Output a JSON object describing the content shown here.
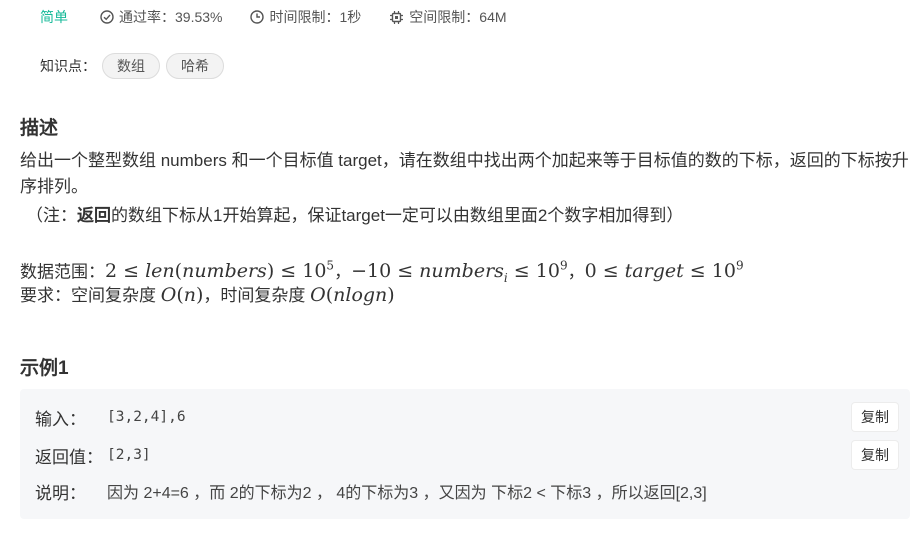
{
  "meta": {
    "difficulty": "简单",
    "pass_rate": "通过率：39.53%",
    "time_limit": "时间限制：1秒",
    "space_limit": "空间限制：64M",
    "difficulty_color": "#16b998"
  },
  "tags": {
    "label": "知识点：",
    "items": [
      "数组",
      "哈希"
    ]
  },
  "description": {
    "heading": "描述",
    "text": "给出一个整型数组 numbers 和一个目标值 target，请在数组中找出两个加起来等于目标值的数的下标，返回的下标按升序排列。",
    "note_prefix": "（注：",
    "note_bold": "返回",
    "note_rest": "的数组下标从1开始算起，保证target一定可以由数组里面2个数字相加得到）",
    "range_label": "数据范围：",
    "requirement_label": "要求：空间复杂度 ",
    "requirement_mid": "，时间复杂度 ",
    "range_math": {
      "c1_two": "2",
      "c1_len": "len",
      "c1_var": "numbers",
      "c1_base": "10",
      "c1_exp": "5",
      "c2_neg": "−10",
      "c2_var": "numbers",
      "c2_sub": "i",
      "c2_base": "10",
      "c2_exp": "9",
      "c3_zero": "0",
      "c3_var": "target",
      "c3_base": "10",
      "c3_exp": "9",
      "space_O": "O",
      "space_arg": "n",
      "time_O": "O",
      "time_arg": "nlogn"
    }
  },
  "example": {
    "heading": "示例1",
    "input_label": "输入：",
    "input_value": "[3,2,4],6",
    "output_label": "返回值：",
    "output_value": "[2,3]",
    "explain_label": "说明：",
    "explain_text": "因为 2+4=6 ，而 2的下标为2 ， 4的下标为3 ，又因为 下标2 < 下标3 ，所以返回[2,3]",
    "copy_label": "复制"
  }
}
